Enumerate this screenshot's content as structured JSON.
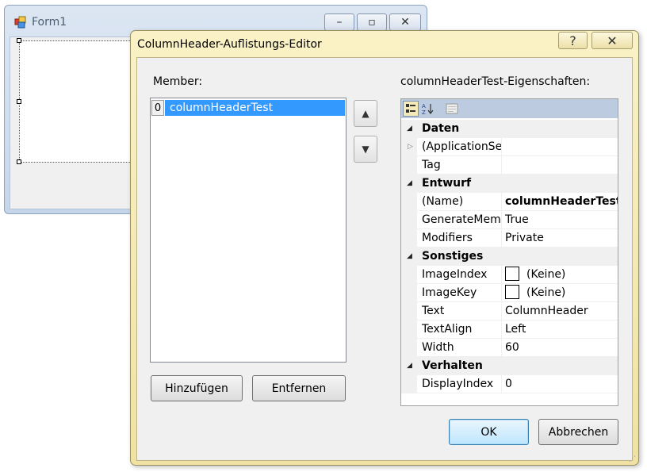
{
  "form1": {
    "title": "Form1",
    "minimize_glyph": "–",
    "restore_glyph": "▫",
    "close_glyph": "✕"
  },
  "dialog": {
    "title": "ColumnHeader-Auflistungs-Editor",
    "help_glyph": "?",
    "close_glyph": "✕",
    "members_label": "Member:",
    "properties_label": "columnHeaderTest-Eigenschaften:",
    "members": [
      {
        "index": "0",
        "name": "columnHeaderTest",
        "selected": true
      }
    ],
    "move_up_glyph": "▲",
    "move_down_glyph": "▼",
    "add_label": "Hinzufügen",
    "remove_label": "Entfernen",
    "ok_label": "OK",
    "cancel_label": "Abbrechen",
    "toolbar_icons": [
      "categorized-icon",
      "alphabetical-icon",
      "property-pages-icon"
    ],
    "property_grid": {
      "categories": [
        {
          "name": "Daten",
          "rows": [
            {
              "name": "(ApplicationSe",
              "value": "",
              "expandable": true
            },
            {
              "name": "Tag",
              "value": ""
            }
          ]
        },
        {
          "name": "Entwurf",
          "rows": [
            {
              "name": "(Name)",
              "value": "columnHeaderTest",
              "bold": true
            },
            {
              "name": "GenerateMemb",
              "value": "True"
            },
            {
              "name": "Modifiers",
              "value": "Private"
            }
          ]
        },
        {
          "name": "Sonstiges",
          "rows": [
            {
              "name": "ImageIndex",
              "value": "(Keine)",
              "swatch": true
            },
            {
              "name": "ImageKey",
              "value": "(Keine)",
              "swatch": true
            },
            {
              "name": "Text",
              "value": "ColumnHeader"
            },
            {
              "name": "TextAlign",
              "value": "Left"
            },
            {
              "name": "Width",
              "value": "60"
            }
          ]
        },
        {
          "name": "Verhalten",
          "rows": [
            {
              "name": "DisplayIndex",
              "value": "0"
            }
          ]
        }
      ]
    }
  },
  "colors": {
    "selection": "#3399ff",
    "dialog_frame": "#efe2a2",
    "form_frame": "#c6d6ea",
    "pg_toolbar": "#bccbe0"
  }
}
